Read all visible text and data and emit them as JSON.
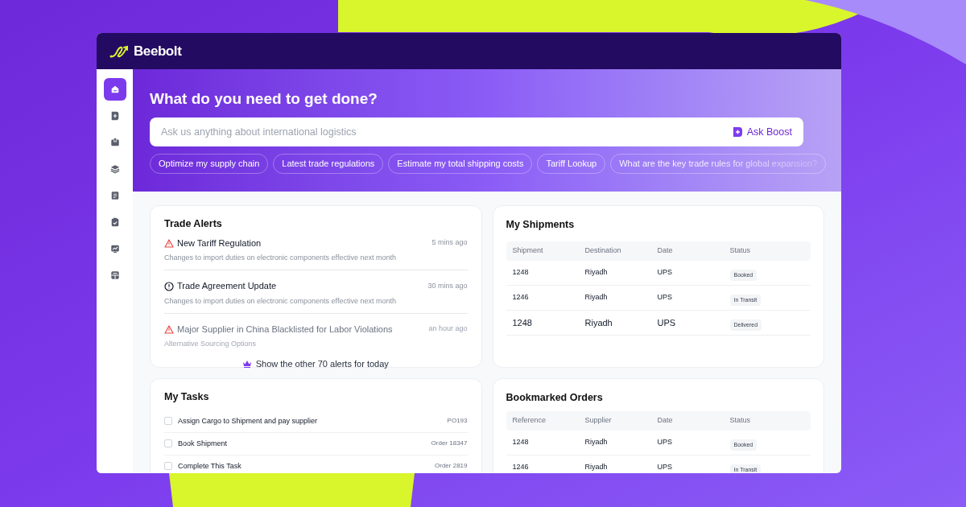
{
  "brand": {
    "name": "Beebolt"
  },
  "sidebar": {
    "items": [
      {
        "kind": "home",
        "selected": true
      },
      {
        "kind": "boost",
        "selected": false
      },
      {
        "kind": "box",
        "selected": false
      },
      {
        "kind": "layers",
        "selected": false
      },
      {
        "kind": "document",
        "selected": false
      },
      {
        "kind": "clipboard",
        "selected": false
      },
      {
        "kind": "chart",
        "selected": false
      },
      {
        "kind": "grid",
        "selected": false
      }
    ]
  },
  "hero": {
    "title": "What do you need to get done?",
    "search": {
      "placeholder": "Ask us anything about international logistics",
      "button": "Ask Boost"
    },
    "suggestions": [
      {
        "label": "Optimize my supply chain",
        "faded": false
      },
      {
        "label": "Latest trade regulations",
        "faded": false
      },
      {
        "label": "Estimate my total shipping costs",
        "faded": false
      },
      {
        "label": "Tariff Lookup",
        "faded": false
      },
      {
        "label": "What are the key trade rules for global expansion?",
        "faded": true
      }
    ]
  },
  "trade_alerts": {
    "title": "Trade Alerts",
    "items": [
      {
        "kind": "warning",
        "title": "New Tariff Regulation",
        "time": "5 mins ago",
        "detail": "Changes to import duties on electronic components effective next month",
        "faded": false
      },
      {
        "kind": "info",
        "title": "Trade Agreement Update",
        "time": "30 mins ago",
        "detail": "Changes to import duties on electronic components effective next month",
        "faded": false
      },
      {
        "kind": "warning",
        "title": "Major Supplier in China Blacklisted for Labor Violations",
        "time": "an hour ago",
        "detail": "Alternative Sourcing Options",
        "faded": true
      }
    ],
    "more": "Show the other 70 alerts for today"
  },
  "shipments": {
    "title": "My Shipments",
    "columns": [
      "Shipment",
      "Destination",
      "Date",
      "Status"
    ],
    "rows": [
      {
        "cells": [
          "1248",
          "Riyadh",
          "UPS"
        ],
        "status": "Booked",
        "large": false
      },
      {
        "cells": [
          "1246",
          "Riyadh",
          "UPS"
        ],
        "status": "In Transit",
        "large": false
      },
      {
        "cells": [
          "1248",
          "Riyadh",
          "UPS"
        ],
        "status": "Delivered",
        "large": true
      }
    ]
  },
  "tasks": {
    "title": "My Tasks",
    "items": [
      {
        "label": "Assign Cargo to Shipment and pay supplier",
        "reference": "PO193",
        "checked": false
      },
      {
        "label": "Book Shipment",
        "reference": "Order 18347",
        "checked": false
      },
      {
        "label": "Complete This Task",
        "reference": "Order 2819",
        "checked": false
      }
    ]
  },
  "bookmarked_orders": {
    "title": "Bookmarked Orders",
    "columns": [
      "Reference",
      "Supplier",
      "Date",
      "Status"
    ],
    "rows": [
      {
        "cells": [
          "1248",
          "Riyadh",
          "UPS"
        ],
        "status": "Booked",
        "large": false
      },
      {
        "cells": [
          "1246",
          "Riyadh",
          "UPS"
        ],
        "status": "In Transit",
        "large": false
      }
    ]
  }
}
